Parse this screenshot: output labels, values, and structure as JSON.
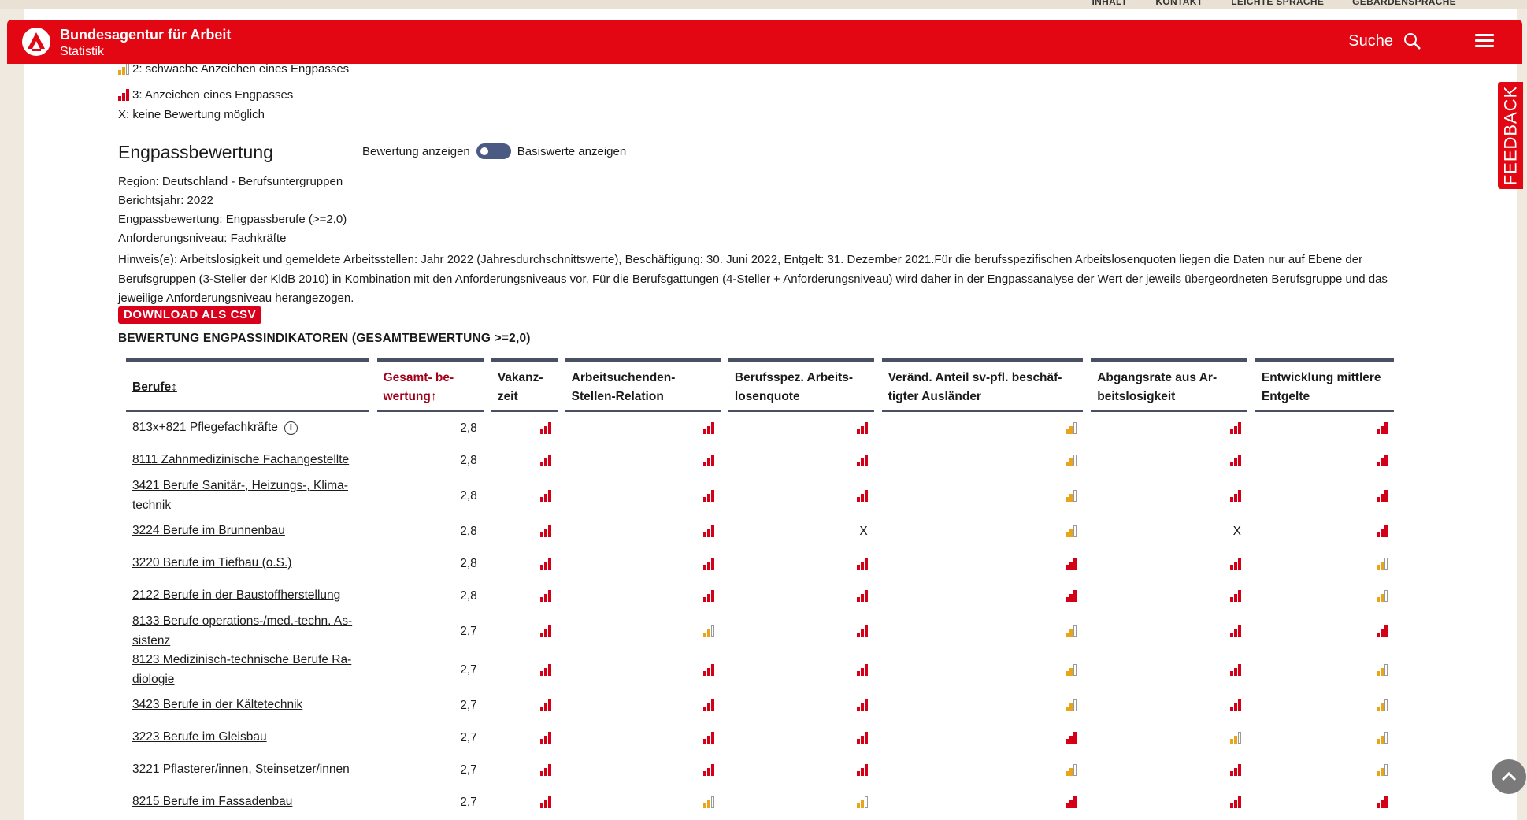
{
  "header": {
    "brand_line1": "Bundesagentur für Arbeit",
    "brand_line2": "Statistik",
    "search_label": "Suche",
    "utility": [
      "INHALT",
      "KONTAKT",
      "LEICHTE SPRACHE",
      "GEBÄRDENSPRACHE"
    ],
    "accent": "#e30613"
  },
  "feedback_label": "FEEDBACK",
  "legend": {
    "item2": "2: schwache Anzeichen eines Engpasses",
    "item3": "3: Anzeichen eines Engpasses",
    "itemX": "X: keine Bewertung möglich"
  },
  "section": {
    "title": "Engpassbewertung",
    "toggle_left": "Bewertung anzeigen",
    "toggle_right": "Basiswerte anzeigen",
    "meta": [
      "Region: Deutschland - Berufsuntergruppen",
      "Berichtsjahr: 2022",
      "Engpassbewertung: Engpassberufe (>=2,0)",
      "Anforderungsniveau: Fachkräfte"
    ],
    "hint": "Hinweis(e): Arbeitslosigkeit und gemeldete Arbeitsstellen: Jahr 2022 (Jahresdurchschnittswerte), Beschäftigung: 30. Juni 2022, Entgelt: 31. Dezember 2021.Für die berufsspezifischen Arbeitslosenquoten liegen die Daten nur auf Ebene der Berufsgruppen (3-Steller der KldB 2010) in Kombination mit den Anforderungsniveaus vor. Für die Berufsgattungen (4-Steller + Anforderungsniveau) wird daher in der Engpassanalyse der Wert der jeweils übergeordneten Berufsgruppe und das jeweilige Anforderungsniveau herangezogen.",
    "download_label": "DOWNLOAD ALS CSV",
    "table_title": "BEWERTUNG ENGPASSINDIKATOREN (GESAMTBEWERTUNG >=2,0)"
  },
  "table": {
    "headers": [
      "Berufe↕",
      "Gesamt- be- wertung↑",
      "Vakanz- zeit",
      "Arbeitsuchenden- Stellen-Relation",
      "Berufsspez. Arbeits- losenquote",
      "Veränd. Anteil sv-pfl. beschäf- tigter Ausländer",
      "Abgangsrate aus Ar- beitslosigkeit",
      "Entwicklung mittlere Entgelte"
    ],
    "rows": [
      {
        "name": "813x+821 Pflegefachkräfte",
        "score": "2,8",
        "ind": [
          "3",
          "3",
          "3",
          "2",
          "3",
          "3"
        ],
        "info": true
      },
      {
        "name": "8111 Zahnmedizinische Fachangestellte",
        "score": "2,8",
        "ind": [
          "3",
          "3",
          "3",
          "2",
          "3",
          "3"
        ]
      },
      {
        "name": "3421 Berufe Sanitär-, Heizungs-, Klima- technik",
        "score": "2,8",
        "ind": [
          "3",
          "3",
          "3",
          "2",
          "3",
          "3"
        ]
      },
      {
        "name": "3224 Berufe im Brunnenbau",
        "score": "2,8",
        "ind": [
          "3",
          "3",
          "X",
          "2",
          "X",
          "3"
        ]
      },
      {
        "name": "3220 Berufe im Tiefbau (o.S.)",
        "score": "2,8",
        "ind": [
          "3",
          "3",
          "3",
          "3",
          "3",
          "2"
        ]
      },
      {
        "name": "2122 Berufe in der Baustoffherstellung",
        "score": "2,8",
        "ind": [
          "3",
          "3",
          "3",
          "3",
          "3",
          "2"
        ]
      },
      {
        "name": "8133 Berufe operations-/med.-techn. As- sistenz",
        "score": "2,7",
        "ind": [
          "3",
          "2",
          "3",
          "2",
          "3",
          "3"
        ]
      },
      {
        "name": "8123 Medizinisch-technische Berufe Ra- diologie",
        "score": "2,7",
        "ind": [
          "3",
          "3",
          "3",
          "2",
          "3",
          "2"
        ]
      },
      {
        "name": "3423 Berufe in der Kältetechnik",
        "score": "2,7",
        "ind": [
          "3",
          "3",
          "3",
          "2",
          "3",
          "2"
        ]
      },
      {
        "name": "3223 Berufe im Gleisbau",
        "score": "2,7",
        "ind": [
          "3",
          "3",
          "3",
          "3",
          "2",
          "2"
        ]
      },
      {
        "name": "3221 Pflasterer/innen, Steinsetzer/innen",
        "score": "2,7",
        "ind": [
          "3",
          "3",
          "3",
          "2",
          "3",
          "2"
        ]
      },
      {
        "name": "8215 Berufe im Fassadenbau",
        "score": "2,7",
        "ind": [
          "3",
          "2",
          "2",
          "3",
          "3",
          "3"
        ]
      }
    ]
  }
}
